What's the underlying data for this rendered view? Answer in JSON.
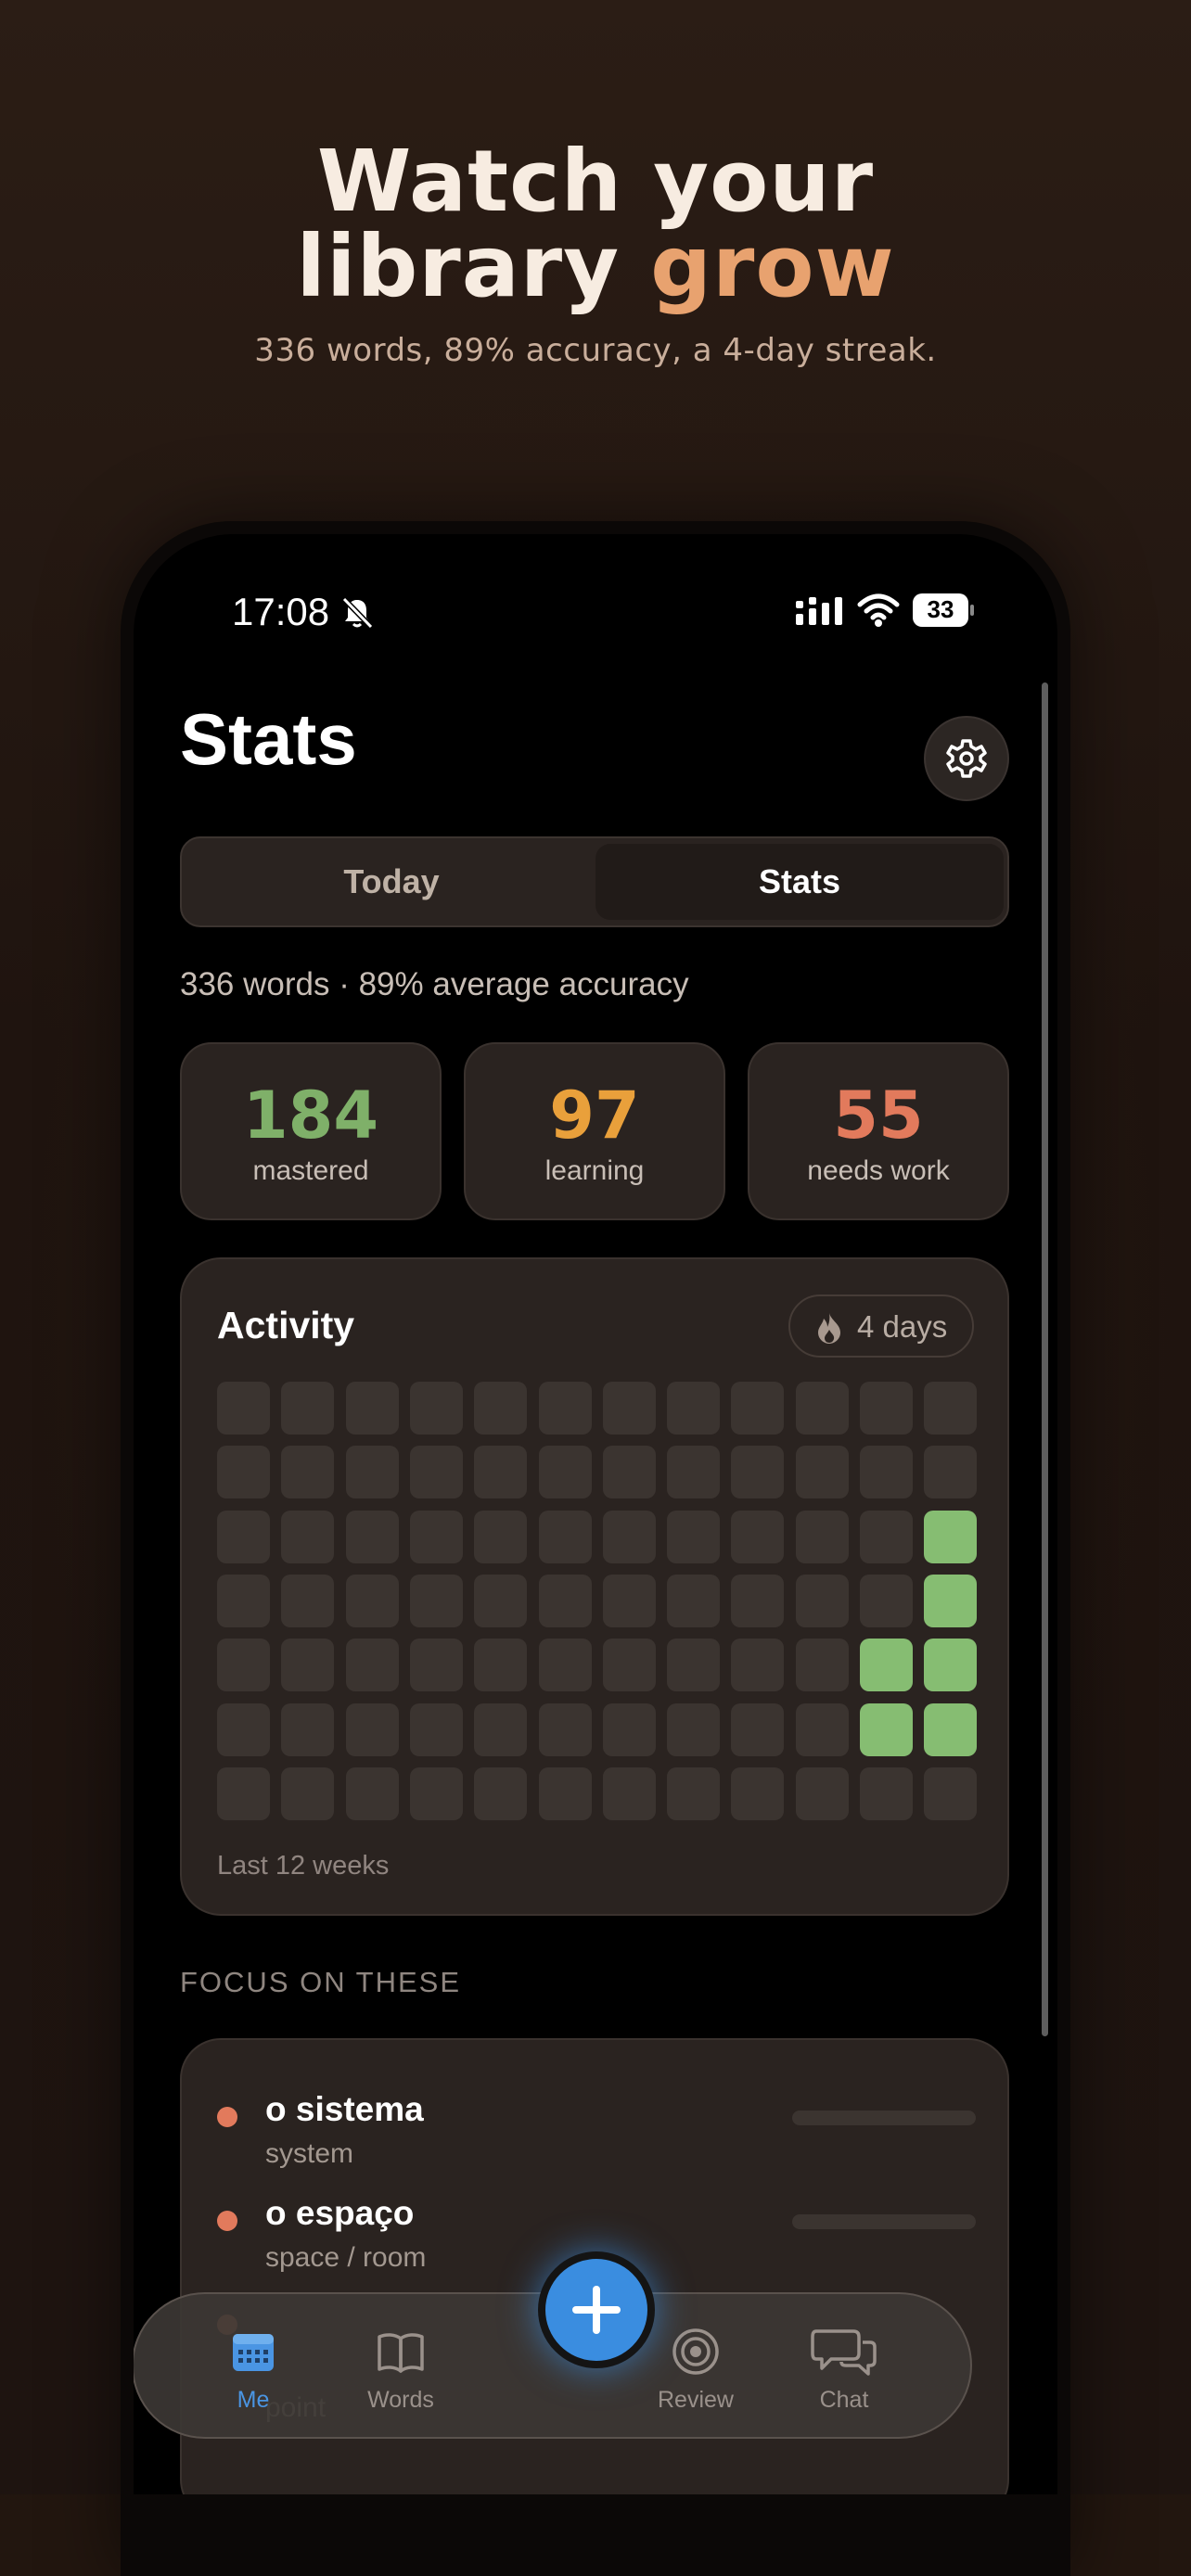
{
  "headline": {
    "line1": "Watch your",
    "line2_plain": "library ",
    "line2_accent": "grow"
  },
  "subhead": "336 words, 89% accuracy, a 4-day streak.",
  "status_bar": {
    "time": "17:08",
    "battery": "33"
  },
  "page_title": "Stats",
  "segments": {
    "today": "Today",
    "stats": "Stats",
    "selected": "Stats"
  },
  "summary": "336 words · 89% average accuracy",
  "stat_cards": [
    {
      "value": "184",
      "label": "mastered",
      "color": "#7fb069"
    },
    {
      "value": "97",
      "label": "learning",
      "color": "#e9a03b"
    },
    {
      "value": "55",
      "label": "needs work",
      "color": "#e27a5c"
    }
  ],
  "activity": {
    "title": "Activity",
    "streak": "4 days",
    "caption": "Last 12 weeks",
    "weeks": 12,
    "days_per_week": 7,
    "active_cells": [
      [
        10,
        4
      ],
      [
        10,
        5
      ],
      [
        11,
        2
      ],
      [
        11,
        3
      ],
      [
        11,
        4
      ],
      [
        11,
        5
      ]
    ]
  },
  "focus": {
    "header": "FOCUS ON THESE",
    "items": [
      {
        "word": "o sistema",
        "translation": "system"
      },
      {
        "word": "o espaço",
        "translation": "space / room"
      },
      {
        "word": "",
        "translation": "point"
      }
    ]
  },
  "tab_bar": {
    "items": [
      {
        "label": "Me",
        "icon": "calendar-icon",
        "active": true
      },
      {
        "label": "Words",
        "icon": "book-icon",
        "active": false
      },
      {
        "label": "Review",
        "icon": "target-icon",
        "active": false
      },
      {
        "label": "Chat",
        "icon": "chat-bubbles-icon",
        "active": false
      }
    ],
    "add_icon": "plus-icon"
  },
  "colors": {
    "accent": "#e8a26f",
    "active_tab": "#4a95e3",
    "heat_on": "#86bd72",
    "add_button": "#3a8de0"
  }
}
